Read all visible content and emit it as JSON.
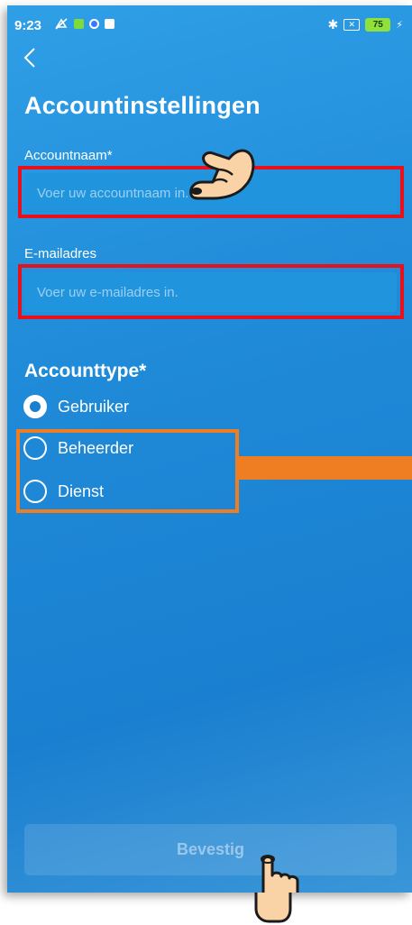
{
  "status_bar": {
    "time": "9:23",
    "battery": "75",
    "icons": [
      "silent-icon",
      "app-notification-icon",
      "location-icon",
      "image-icon",
      "bluetooth-icon",
      "sim-icon",
      "charging-icon"
    ]
  },
  "header": {
    "back_glyph": "‹",
    "title": "Accountinstellingen"
  },
  "form": {
    "account_name": {
      "label": "Accountnaam*",
      "placeholder": "Voer uw accountnaam in.",
      "value": ""
    },
    "email": {
      "label": "E-mailadres",
      "placeholder": "Voer uw e-mailadres in.",
      "value": ""
    },
    "account_type": {
      "title": "Accounttype*",
      "options": [
        {
          "label": "Gebruiker",
          "checked": true
        },
        {
          "label": "Beheerder",
          "checked": false
        },
        {
          "label": "Dienst",
          "checked": false
        }
      ]
    }
  },
  "confirm_button": {
    "label": "Bevestig"
  },
  "annotations": {
    "highlight_red": "#e8111b",
    "highlight_orange": "#ef7d22"
  }
}
